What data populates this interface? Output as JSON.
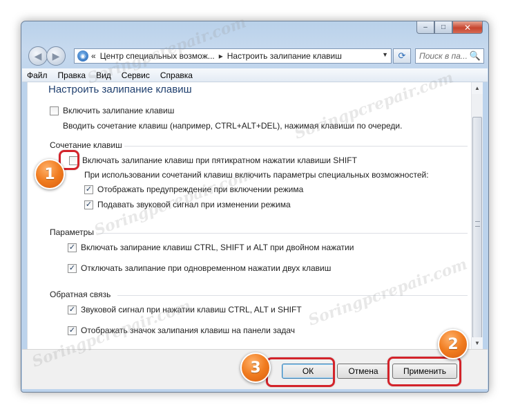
{
  "window": {
    "caption_minimize": "‒",
    "caption_maximize": "□",
    "caption_close": "✕"
  },
  "navbar": {
    "back_glyph": "◀",
    "forward_glyph": "▶",
    "address_prefix": "«",
    "breadcrumb_parent": "Центр специальных возмож...",
    "breadcrumb_current": "Настроить залипание клавиш",
    "breadcrumb_separator": "▸",
    "refresh_glyph": "⟳",
    "search_placeholder": "Поиск в па...",
    "search_icon": "🔍"
  },
  "menu": {
    "items": [
      "Файл",
      "Правка",
      "Вид",
      "Сервис",
      "Справка"
    ]
  },
  "page": {
    "title": "Настроить залипание клавиш",
    "enable_sticky_label": "Включить залипание клавиш",
    "enable_sticky_checked": false,
    "enable_sticky_desc": "Вводить сочетание клавиш (например, CTRL+ALT+DEL), нажимая клавиши по очереди.",
    "shortcut_group": "Сочетание клавиш",
    "shift5_label": "Включать залипание клавиш при пятикратном нажатии клавиши SHIFT",
    "shift5_checked": false,
    "shift5_desc": "При использовании сочетаний клавиш включить параметры специальных возможностей:",
    "warn_label": "Отображать предупреждение при включении режима",
    "warn_checked": true,
    "sound_label": "Подавать звуковой сигнал при изменении режима",
    "sound_checked": true,
    "params_group": "Параметры",
    "lock_label": "Включать запирание клавиш CTRL, SHIFT и ALT при двойном нажатии",
    "lock_checked": true,
    "off_label": "Отключать залипание при одновременном нажатии двух клавиш",
    "off_checked": true,
    "feedback_group": "Обратная связь",
    "beep_label": "Звуковой сигнал при нажатии клавиш CTRL, ALT и SHIFT",
    "beep_checked": true,
    "icon_label": "Отображать значок залипания клавиш на панели задач",
    "icon_checked": true
  },
  "footer": {
    "ok_label": "ОК",
    "cancel_label": "Отмена",
    "apply_label": "Применить"
  },
  "annotations": {
    "badge_1": "1",
    "badge_2": "2",
    "badge_3": "3",
    "highlight_color": "#d3232a",
    "badge_color": "#f07c20"
  },
  "watermark": {
    "text": "Soringpcrepair.com"
  }
}
